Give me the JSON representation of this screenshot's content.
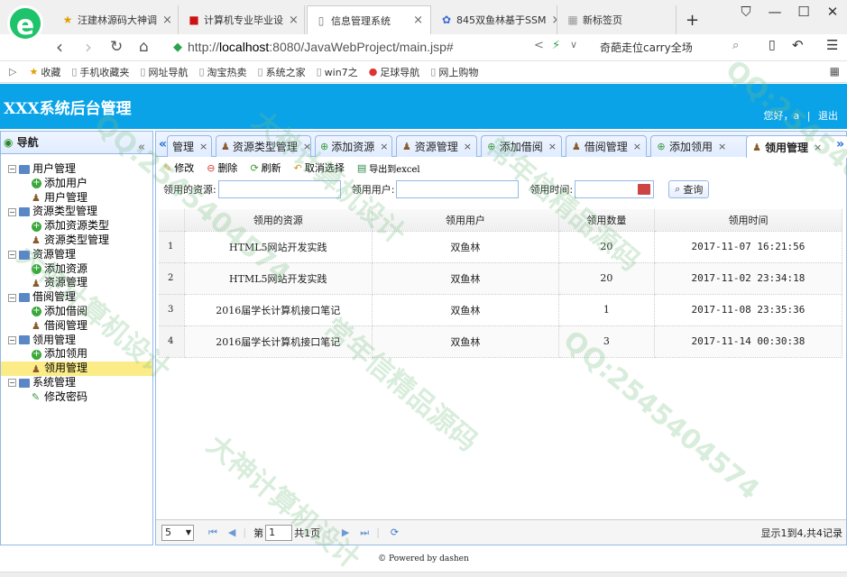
{
  "browser": {
    "tabs": [
      {
        "label": "汪建林源码大神调",
        "icon": "star-icon"
      },
      {
        "label": "计算机专业毕业设",
        "icon": "red-square-icon"
      },
      {
        "label": "信息管理系统",
        "icon": "page-icon",
        "active": true
      },
      {
        "label": "845双鱼林基于SSM",
        "icon": "gear-icon"
      },
      {
        "label": "新标签页",
        "icon": "grid-icon"
      }
    ],
    "url_prefix": "http://",
    "url_host": "localhost",
    "url_rest": ":8080/JavaWebProject/main.jsp#",
    "search_hint": "奇葩走位carry全场",
    "bookmarks": [
      "收藏",
      "手机收藏夹",
      "网址导航",
      "淘宝热卖",
      "系统之家",
      "win7之",
      "足球导航",
      "网上购物"
    ]
  },
  "app": {
    "title": "XXX系统后台管理",
    "greeting": "您好，a",
    "separator": "|",
    "logout": "退出"
  },
  "nav": {
    "title": "导航",
    "groups": [
      {
        "label": "用户管理",
        "items": [
          {
            "label": "添加用户",
            "icon": "add"
          },
          {
            "label": "用户管理",
            "icon": "user"
          }
        ]
      },
      {
        "label": "资源类型管理",
        "items": [
          {
            "label": "添加资源类型",
            "icon": "add"
          },
          {
            "label": "资源类型管理",
            "icon": "user"
          }
        ]
      },
      {
        "label": "资源管理",
        "items": [
          {
            "label": "添加资源",
            "icon": "add"
          },
          {
            "label": "资源管理",
            "icon": "user"
          }
        ]
      },
      {
        "label": "借阅管理",
        "items": [
          {
            "label": "添加借阅",
            "icon": "add"
          },
          {
            "label": "借阅管理",
            "icon": "user"
          }
        ]
      },
      {
        "label": "领用管理",
        "items": [
          {
            "label": "添加领用",
            "icon": "add"
          },
          {
            "label": "领用管理",
            "icon": "user",
            "selected": true
          }
        ]
      },
      {
        "label": "系统管理",
        "items": [
          {
            "label": "修改密码",
            "icon": "pencil"
          }
        ]
      }
    ]
  },
  "panel_tabs": [
    {
      "label": "管理",
      "icon": "",
      "x": 0
    },
    {
      "label": "资源类型管理",
      "icon": "user"
    },
    {
      "label": "添加资源",
      "icon": "add"
    },
    {
      "label": "资源管理",
      "icon": "user"
    },
    {
      "label": "添加借阅",
      "icon": "add"
    },
    {
      "label": "借阅管理",
      "icon": "user"
    },
    {
      "label": "添加领用",
      "icon": "add"
    },
    {
      "label": "领用管理",
      "icon": "user",
      "active": true
    }
  ],
  "toolbar": {
    "edit": "修改",
    "delete": "删除",
    "refresh": "刷新",
    "deselect": "取消选择",
    "export": "导出到excel"
  },
  "search": {
    "resource_label": "领用的资源:",
    "user_label": "领用用户:",
    "time_label": "领用时间:",
    "query": "查询"
  },
  "grid": {
    "columns": [
      "领用的资源",
      "领用用户",
      "领用数量",
      "领用时间"
    ],
    "rows": [
      {
        "n": "1",
        "resource": "HTML5网站开发实践",
        "user": "双鱼林",
        "qty": "20",
        "time": "2017-11-07 16:21:56"
      },
      {
        "n": "2",
        "resource": "HTML5网站开发实践",
        "user": "双鱼林",
        "qty": "20",
        "time": "2017-11-02 23:34:18"
      },
      {
        "n": "3",
        "resource": "2016届学长计算机接口笔记",
        "user": "双鱼林",
        "qty": "1",
        "time": "2017-11-08 23:35:36"
      },
      {
        "n": "4",
        "resource": "2016届学长计算机接口笔记",
        "user": "双鱼林",
        "qty": "3",
        "time": "2017-11-14 00:30:38"
      }
    ]
  },
  "pager": {
    "page_size": "5",
    "page_prefix": "第",
    "page_value": "1",
    "page_suffix": "共1页",
    "info": "显示1到4,共4记录"
  },
  "footer": {
    "text": "Powered by dashen",
    "copyright": "©"
  },
  "watermarks": [
    "QQ:2545404574",
    "大神计算机设计",
    "常年信精品源码",
    "QQ:2545404574",
    "大神计算机设计",
    "常年信精品源码",
    "QQ:2545404574",
    "大神计算机设计"
  ]
}
